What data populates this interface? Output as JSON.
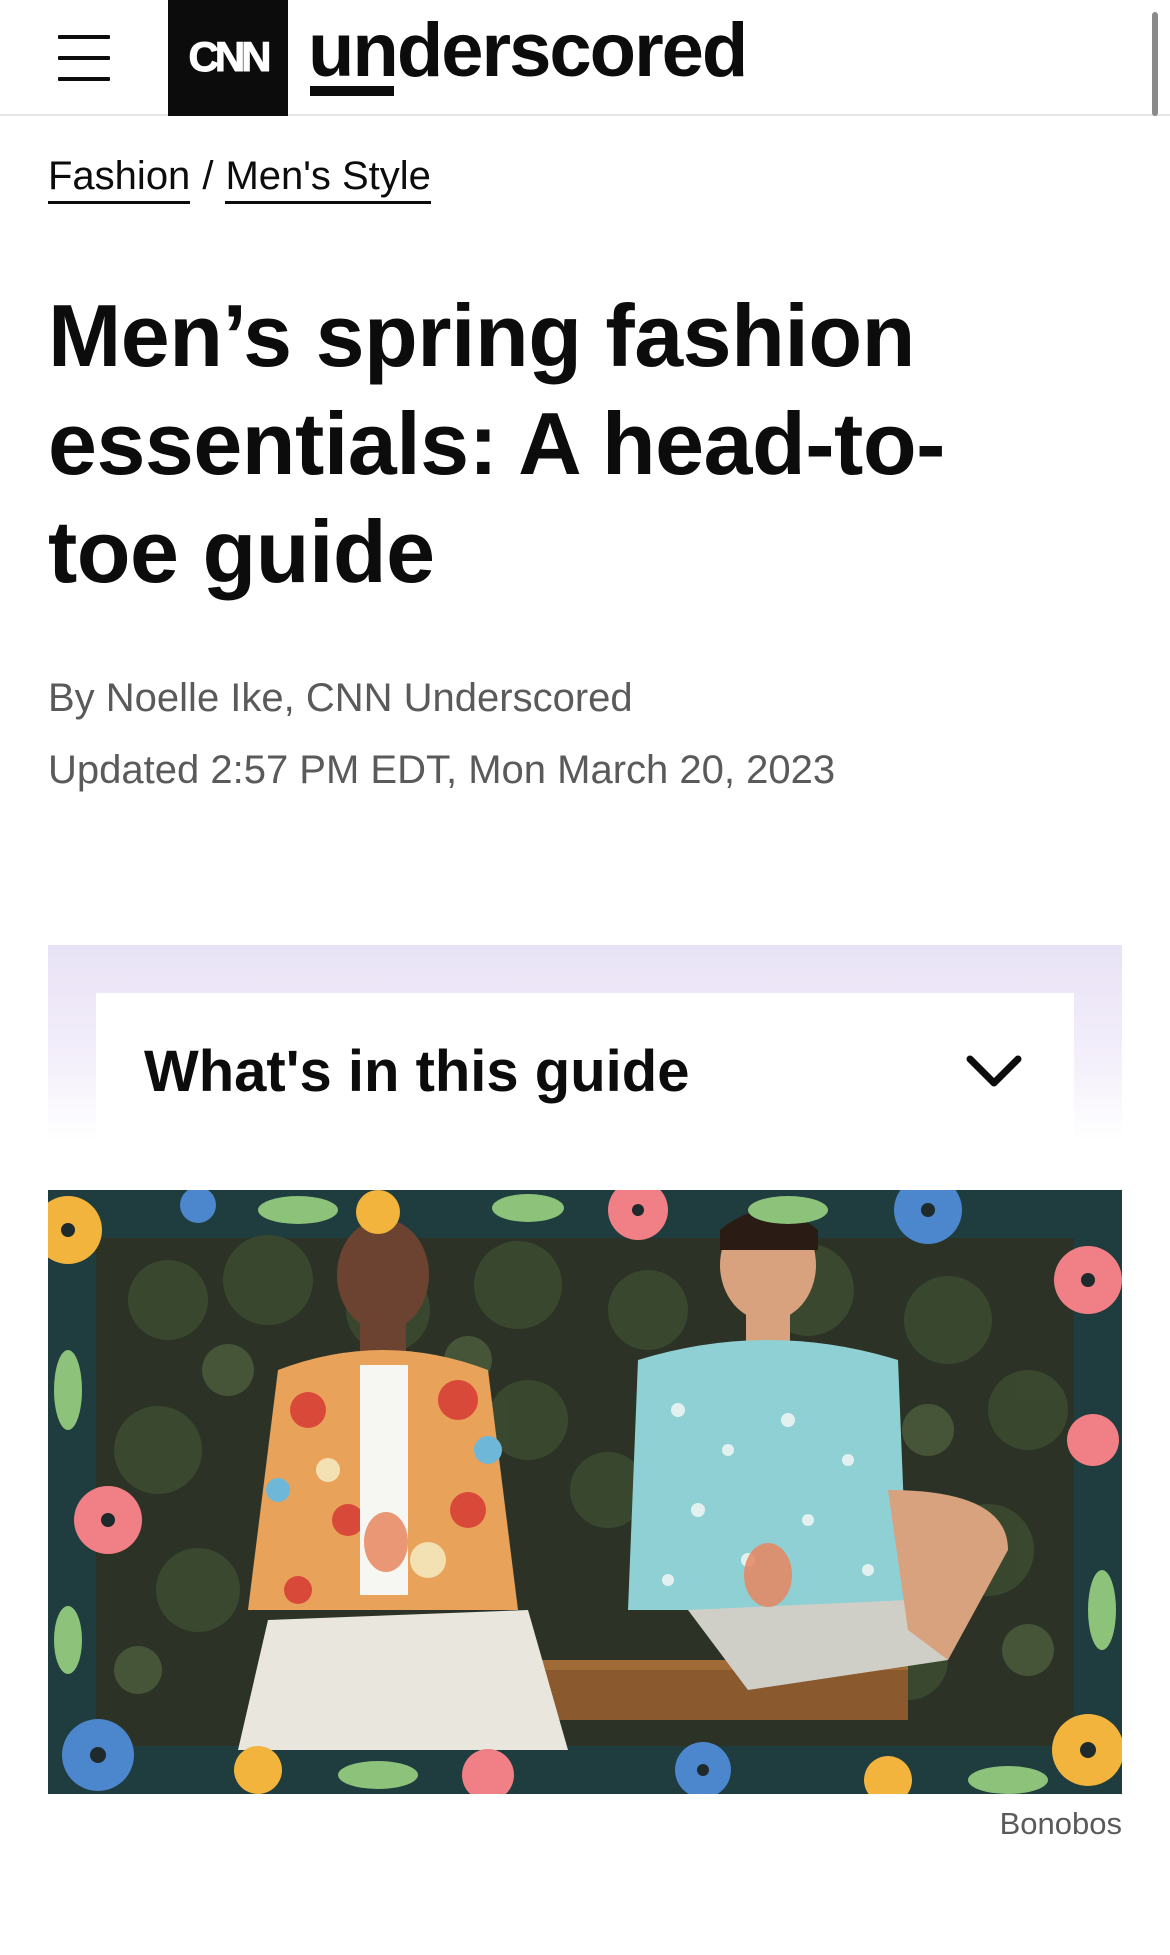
{
  "header": {
    "menu_icon": "hamburger-menu-icon",
    "cnn_logo_text": "CNN",
    "brand_name": "underscored"
  },
  "breadcrumb": {
    "items": [
      "Fashion",
      "Men's Style"
    ],
    "separator": "/"
  },
  "article": {
    "headline_lines": [
      "Men’s spring fashion",
      "essentials: A head-to-",
      "toe guide"
    ],
    "byline": "By Noelle Ike, CNN Underscored",
    "updated": "Updated 2:57 PM EDT, Mon March 20, 2023"
  },
  "guide": {
    "title": "What's in this guide",
    "icon": "chevron-down-icon"
  },
  "hero_image": {
    "credit": "Bonobos"
  },
  "colors": {
    "text": "#0c0c0c",
    "muted": "#5a5a5a",
    "guide_gradient_top": "#e8e2f6",
    "logo_bg": "#0c0c0c"
  }
}
